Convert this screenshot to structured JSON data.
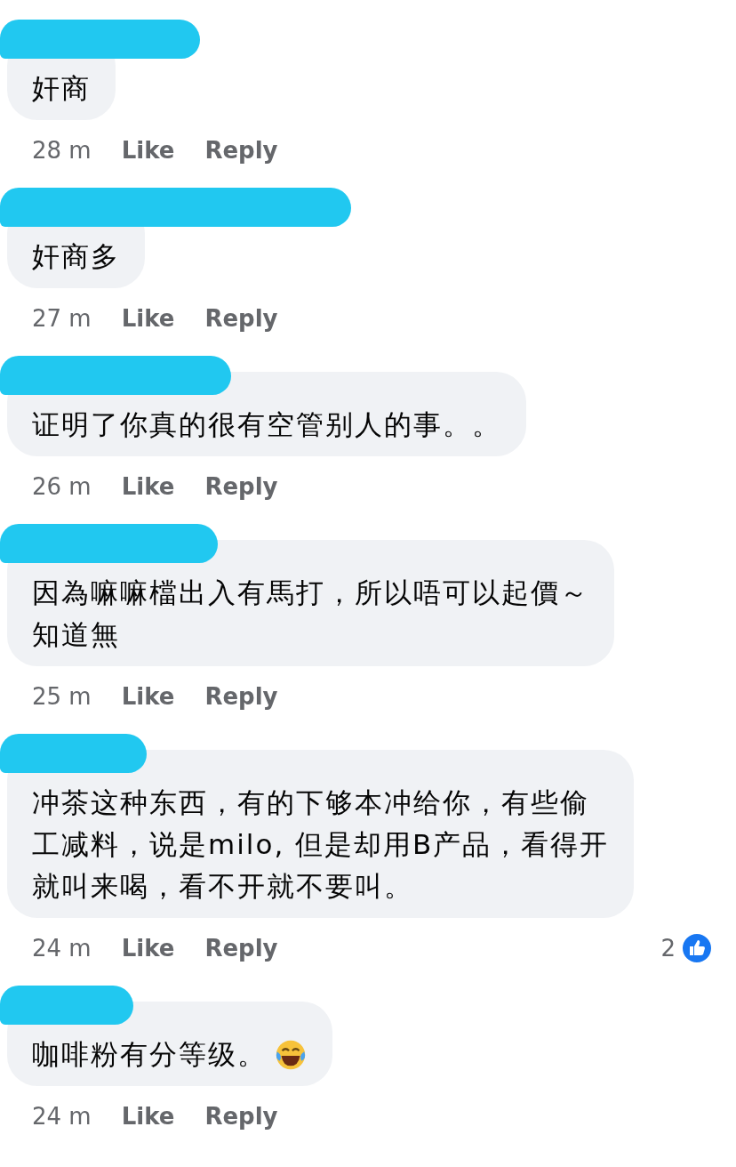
{
  "comments": [
    {
      "lines": [
        "奸商"
      ],
      "time": "28 m",
      "like": "Like",
      "reply": "Reply"
    },
    {
      "lines": [
        "奸商多"
      ],
      "time": "27 m",
      "like": "Like",
      "reply": "Reply"
    },
    {
      "lines": [
        "证明了你真的很有空管别人的事。。"
      ],
      "time": "26 m",
      "like": "Like",
      "reply": "Reply"
    },
    {
      "lines": [
        "因為嘛嘛檔出入有馬打，所以唔可以起價～",
        "知道無"
      ],
      "time": "25 m",
      "like": "Like",
      "reply": "Reply"
    },
    {
      "lines": [
        "冲茶这种东西，有的下够本冲给你，有些偷",
        "工减料，说是milo, 但是却用B产品，看得开",
        "就叫来喝，看不开就不要叫。"
      ],
      "time": "24 m",
      "like": "Like",
      "reply": "Reply",
      "reaction_count": "2"
    },
    {
      "lines": [
        "咖啡粉有分等级。"
      ],
      "laughing_emoji": true,
      "time": "24 m",
      "like": "Like",
      "reply": "Reply"
    }
  ]
}
